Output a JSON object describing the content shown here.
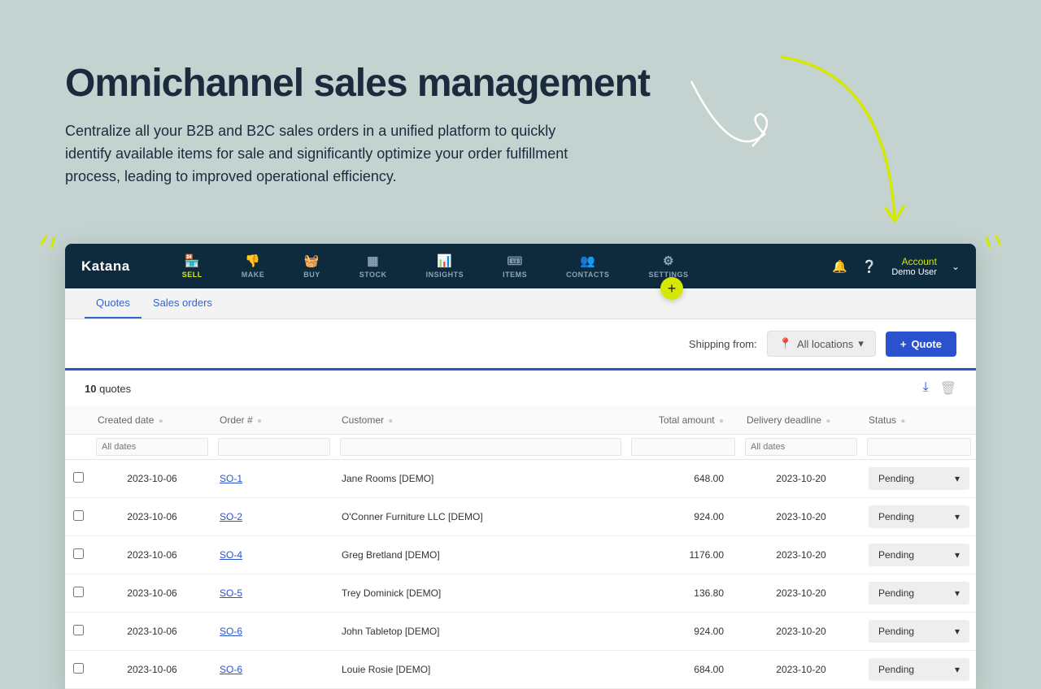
{
  "hero": {
    "title": "Omnichannel sales management",
    "subtitle": "Centralize all your B2B and B2C sales orders in a unified platform to quickly identify available items for sale and significantly optimize your order fulfillment process, leading to improved operational efficiency."
  },
  "logo": "Katana",
  "nav": [
    {
      "label": "SELL",
      "icon": "🏪",
      "active": true
    },
    {
      "label": "MAKE",
      "icon": "👎",
      "active": false
    },
    {
      "label": "BUY",
      "icon": "🧺",
      "active": false
    },
    {
      "label": "STOCK",
      "icon": "▦",
      "active": false
    },
    {
      "label": "INSIGHTS",
      "icon": "📊",
      "active": false
    },
    {
      "label": "ITEMS",
      "icon": "🎟",
      "active": false
    },
    {
      "label": "CONTACTS",
      "icon": "👥",
      "active": false
    },
    {
      "label": "SETTINGS",
      "icon": "⚙",
      "active": false
    }
  ],
  "account": {
    "label": "Account",
    "user": "Demo User"
  },
  "tabs": [
    {
      "label": "Quotes",
      "active": true
    },
    {
      "label": "Sales orders",
      "active": false
    }
  ],
  "toolbar": {
    "ship_label": "Shipping from:",
    "location": "All locations",
    "quote_btn": "Quote"
  },
  "count": {
    "n": "10",
    "unit": "quotes"
  },
  "columns": [
    "Created date",
    "Order #",
    "Customer",
    "Total amount",
    "Delivery deadline",
    "Status"
  ],
  "filters": {
    "dates": "All dates",
    "deadline": "All dates"
  },
  "rows": [
    {
      "date": "2023-10-06",
      "order": "SO-1",
      "customer": "Jane Rooms [DEMO]",
      "amount": "648.00",
      "deadline": "2023-10-20",
      "status": "Pending"
    },
    {
      "date": "2023-10-06",
      "order": "SO-2",
      "customer": "O'Conner Furniture LLC [DEMO]",
      "amount": "924.00",
      "deadline": "2023-10-20",
      "status": "Pending"
    },
    {
      "date": "2023-10-06",
      "order": "SO-4",
      "customer": "Greg Bretland [DEMO]",
      "amount": "1176.00",
      "deadline": "2023-10-20",
      "status": "Pending"
    },
    {
      "date": "2023-10-06",
      "order": "SO-5",
      "customer": "Trey Dominick [DEMO]",
      "amount": "136.80",
      "deadline": "2023-10-20",
      "status": "Pending"
    },
    {
      "date": "2023-10-06",
      "order": "SO-6",
      "customer": "John Tabletop [DEMO]",
      "amount": "924.00",
      "deadline": "2023-10-20",
      "status": "Pending"
    },
    {
      "date": "2023-10-06",
      "order": "SO-6",
      "customer": "Louie Rosie [DEMO]",
      "amount": "684.00",
      "deadline": "2023-10-20",
      "status": "Pending"
    }
  ]
}
